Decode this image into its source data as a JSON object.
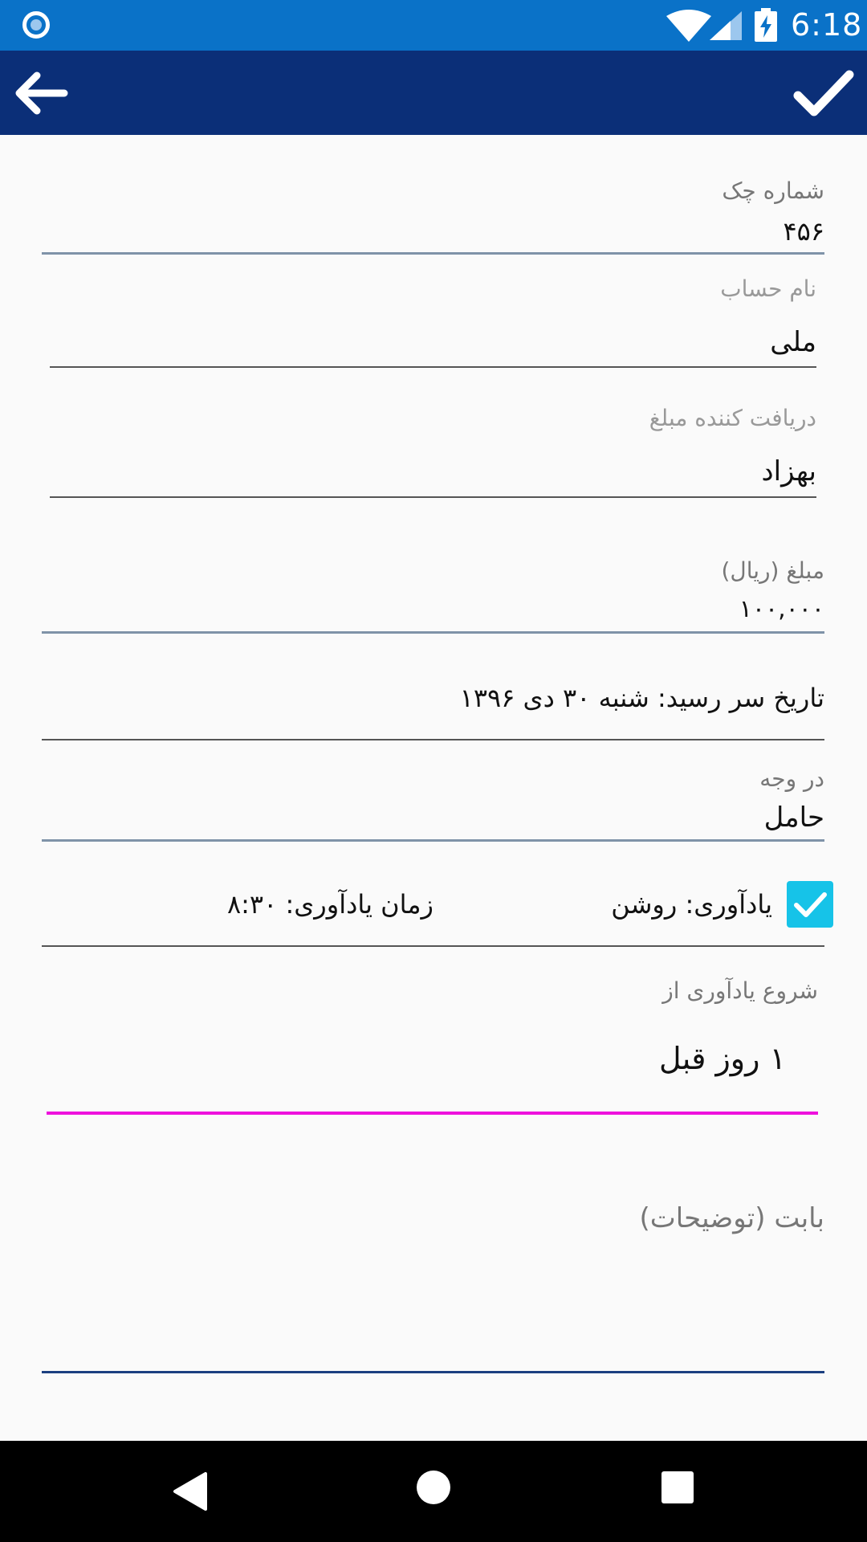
{
  "status_bar": {
    "time": "6:18",
    "notification_icon": "circle-notification-icon",
    "wifi_icon": "wifi-icon",
    "signal_icon": "cell-signal-icon",
    "battery_icon": "battery-charging-icon"
  },
  "app_bar": {
    "back_icon": "arrow-left-icon",
    "confirm_icon": "checkmark-icon",
    "color": "#0b2f78"
  },
  "form": {
    "check_number": {
      "label": "شماره چک",
      "value": "۴۵۶"
    },
    "account_name": {
      "label": "نام حساب",
      "value": "ملی"
    },
    "payee": {
      "label": "دریافت کننده مبلغ",
      "value": "بهزاد"
    },
    "amount": {
      "label": "مبلغ (ریال)",
      "value": "۱۰۰,۰۰۰"
    },
    "due_date": {
      "text": "تاریخ سر رسید: شنبه ۳۰ دی ۱۳۹۶"
    },
    "payable_to": {
      "label": "در وجه",
      "value": "حامل"
    },
    "reminder": {
      "checked": true,
      "status_text": "یادآوری: روشن",
      "time_text": "زمان یادآوری: ۸:۳۰"
    },
    "reminder_start": {
      "label": "شروع یادآوری از",
      "value": "۱ روز قبل"
    },
    "description": {
      "placeholder": "بابت (توضیحات)"
    }
  },
  "colors": {
    "status_bar": "#0a72c8",
    "accent_checkbox": "#16c3e8",
    "active_underline": "#ee11dd"
  },
  "nav_bar": {
    "back_icon": "triangle-back-icon",
    "home_icon": "circle-home-icon",
    "recents_icon": "square-recents-icon"
  }
}
